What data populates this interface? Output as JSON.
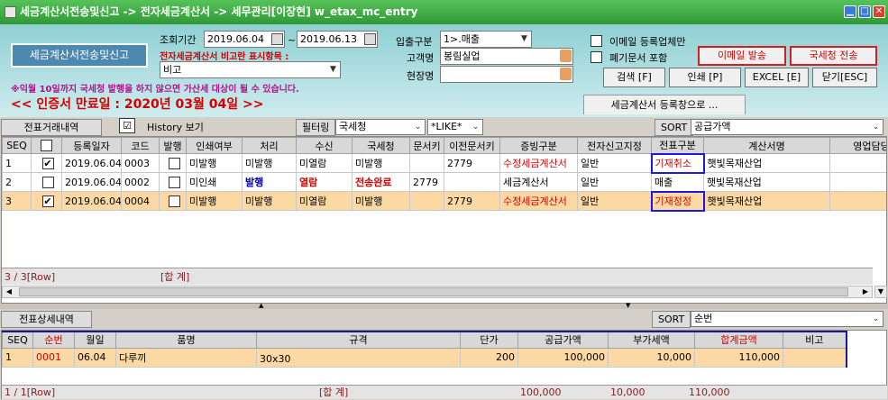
{
  "window": {
    "title": "세금계산서전송및신고 -> 전자세금계산서 -> 세무관리[이장현] w_etax_mc_entry"
  },
  "header": {
    "main_button": "세금계산서전송및신고",
    "period_label": "조회기간",
    "date_from": "2019.06.04",
    "date_sep": "~",
    "date_to": "2019.06.13",
    "note_label": "전자세금계산서 비고란 표시항목 :",
    "note_value": "비고",
    "warning": "※익월 10일까지 국세청 발행을 하지 않으면 가산세 대상이 될 수 있습니다.",
    "deadline": "<< 인증서 만료일 : 2020년 03월 04일 >>",
    "inout_label": "입출구분",
    "inout_value": "1>.매출",
    "customer_label": "고객명",
    "customer_value": "봉림실업",
    "site_label": "현장명",
    "site_value": "",
    "email_only_label": "이메일 등록업체만",
    "closed_doc_label": "폐기문서 포함",
    "email_send_button": "이메일 발송",
    "nts_send_button": "국세청 전송",
    "search_button": "검색 [F]",
    "print_button": "인쇄 [P]",
    "excel_button": "EXCEL [E]",
    "close_button": "닫기[ESC]",
    "register_tab": "세금계산서 등록창으로 ..."
  },
  "upper": {
    "tab_label": "전표거래내역",
    "history_label": "History 보기",
    "filter_label": "필터링",
    "filter_value": "국세청",
    "like_value": "*LIKE*",
    "sort_label": "SORT",
    "sort_value": "공급가액",
    "columns": [
      "SEQ",
      "",
      "등록일자",
      "코드",
      "발행",
      "인쇄여부",
      "처리",
      "수신",
      "국세청",
      "문서키",
      "이전문서키",
      "증빙구분",
      "전자신고지정",
      "전표구분",
      "계산서명",
      "영업담당"
    ],
    "rows": [
      {
        "seq": "1",
        "checked": "✔",
        "date": "2019.06.04",
        "code": "0003",
        "issue": "",
        "print": "미발행",
        "proc": "미발행",
        "recv": "미열람",
        "nts": "미발행",
        "dockey": "",
        "prevkey": "2779",
        "evid": "수정세금계산서",
        "ereport": "일반",
        "slip": "기재취소",
        "name": "햇빛목재산업",
        "sales": ""
      },
      {
        "seq": "2",
        "checked": "",
        "date": "2019.06.04",
        "code": "0002",
        "issue": "",
        "print": "미인쇄",
        "proc": "발행",
        "recv": "열람",
        "nts": "전송완료",
        "dockey": "2779",
        "prevkey": "",
        "evid": "세금계산서",
        "ereport": "일반",
        "slip": "매출",
        "name": "햇빛목재산업",
        "sales": ""
      },
      {
        "seq": "3",
        "checked": "✔",
        "date": "2019.06.04",
        "code": "0004",
        "issue": "",
        "print": "미발행",
        "proc": "미발행",
        "recv": "미열람",
        "nts": "미발행",
        "dockey": "",
        "prevkey": "2779",
        "evid": "수정세금계산서",
        "ereport": "일반",
        "slip": "기재정정",
        "name": "햇빛목재산업",
        "sales": ""
      }
    ],
    "footer_rows": "3 / 3[Row]",
    "footer_total": "[합  계]"
  },
  "lower": {
    "tab_label": "전표상세내역",
    "sort_label": "SORT",
    "sort_value": "순번",
    "columns": [
      "SEQ",
      "순번",
      "월일",
      "품명",
      "규격",
      "단가",
      "공급가액",
      "부가세액",
      "합계금액",
      "비고"
    ],
    "rows": [
      {
        "seq": "1",
        "no": "0001",
        "md": "06.04",
        "item": "다루끼",
        "spec": "30x30",
        "price": "200",
        "supply": "100,000",
        "vat": "10,000",
        "total": "110,000",
        "note": ""
      }
    ],
    "footer_rows": "1 / 1[Row]",
    "footer_total": "[합  계]",
    "footer_supply": "100,000",
    "footer_vat": "10,000",
    "footer_sum": "110,000"
  },
  "colors": {
    "title_green": "#3aa840",
    "header_teal": "#8fd0d3",
    "highlight_row": "#fcd9a3",
    "accent_red": "#d40000"
  }
}
